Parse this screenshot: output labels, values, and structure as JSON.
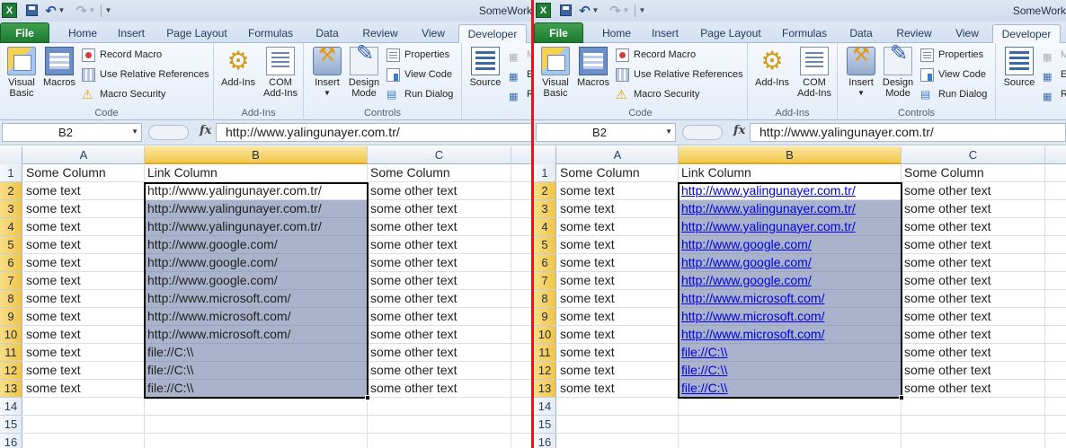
{
  "app": {
    "window_title": "SomeWork",
    "quick_access": {
      "excel_icon_letter": "X"
    },
    "tabs": [
      "File",
      "Home",
      "Insert",
      "Page Layout",
      "Formulas",
      "Data",
      "Review",
      "View",
      "Developer"
    ],
    "active_tab": "Developer",
    "ribbon": {
      "code_group": {
        "label": "Code",
        "visual_basic": [
          "Visual",
          "Basic"
        ],
        "macros": "Macros",
        "record_macro": "Record Macro",
        "relative_references": "Use Relative References",
        "macro_security": "Macro Security"
      },
      "addins_group": {
        "label": "Add-Ins",
        "add_ins": "Add-Ins",
        "com_add_ins": [
          "COM",
          "Add-Ins"
        ]
      },
      "controls_group": {
        "label": "Controls",
        "insert": "Insert",
        "design_mode": [
          "Design",
          "Mode"
        ],
        "properties": "Properties",
        "view_code": "View Code",
        "run_dialog": "Run Dialog"
      },
      "xml_group": {
        "source": "Source",
        "left_cut": {
          "map": "M",
          "expand": "Ex",
          "refresh": "R"
        },
        "right_cut": {
          "map": "M",
          "expand": "Ex",
          "refresh": "Re"
        }
      }
    },
    "formula_bar": {
      "name_box": "B2",
      "fx_label": "fx",
      "formula": "http://www.yalingunayer.com.tr/"
    },
    "columns": [
      "A",
      "B",
      "C"
    ],
    "selected_column": "B",
    "visible_rows": [
      1,
      2,
      3,
      4,
      5,
      6,
      7,
      8,
      9,
      10,
      11,
      12,
      13,
      14,
      15,
      16
    ]
  },
  "sheet": {
    "headers": [
      "Some Column",
      "Link Column",
      "Some Column"
    ],
    "rows": [
      [
        "some text",
        "http://www.yalingunayer.com.tr/",
        "some other text"
      ],
      [
        "some text",
        "http://www.yalingunayer.com.tr/",
        "some other text"
      ],
      [
        "some text",
        "http://www.yalingunayer.com.tr/",
        "some other text"
      ],
      [
        "some text",
        "http://www.google.com/",
        "some other text"
      ],
      [
        "some text",
        "http://www.google.com/",
        "some other text"
      ],
      [
        "some text",
        "http://www.google.com/",
        "some other text"
      ],
      [
        "some text",
        "http://www.microsoft.com/",
        "some other text"
      ],
      [
        "some text",
        "http://www.microsoft.com/",
        "some other text"
      ],
      [
        "some text",
        "http://www.microsoft.com/",
        "some other text"
      ],
      [
        "some text",
        "file://C:\\\\",
        "some other text"
      ],
      [
        "some text",
        "file://C:\\\\",
        "some other text"
      ],
      [
        "some text",
        "file://C:\\\\",
        "some other text"
      ]
    ]
  },
  "colors": {
    "selection_fill": "#a9b3cb",
    "hyperlink": "#0000e0",
    "divider": "#e8141b",
    "file_tab": "#1d7a30"
  }
}
